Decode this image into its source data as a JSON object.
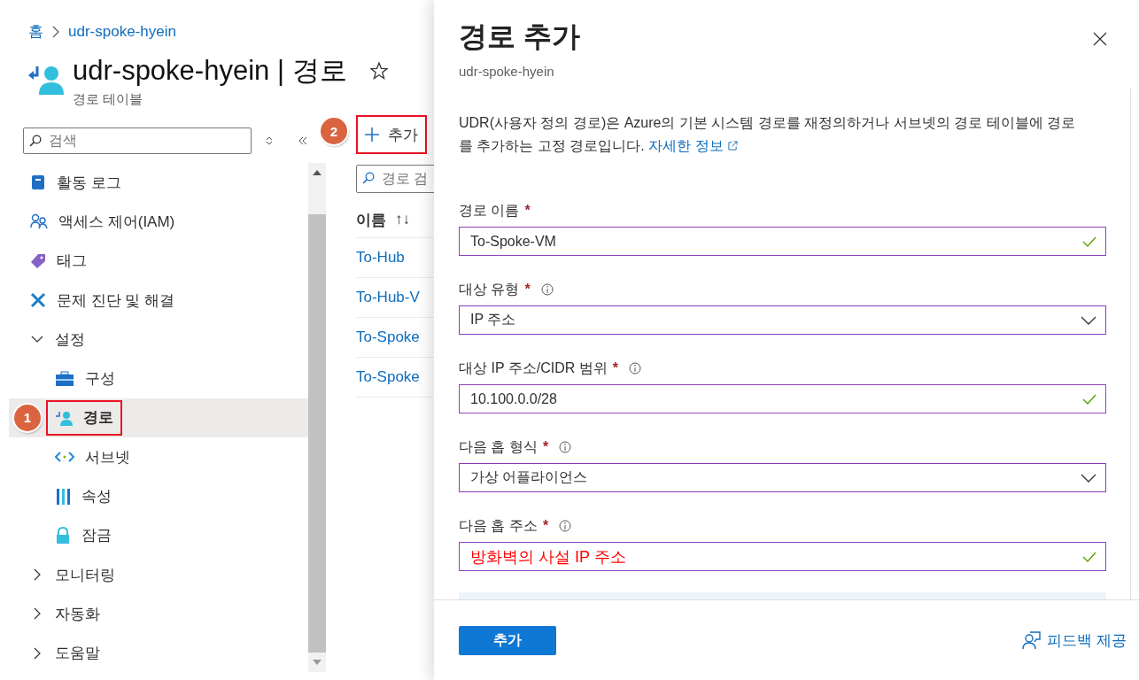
{
  "breadcrumb": [
    {
      "label": "홈"
    },
    {
      "label": "udr-spoke-hyein"
    }
  ],
  "resource": {
    "title": "udr-spoke-hyein | 경로",
    "subtitle": "경로 테이블",
    "favorite": false
  },
  "sidebar": {
    "search": {
      "placeholder": "검색"
    },
    "items": [
      {
        "label": "활동 로그",
        "selected": false
      },
      {
        "label": "액세스 제어(IAM)",
        "selected": false
      },
      {
        "label": "태그",
        "selected": false
      },
      {
        "label": "문제 진단 및 해결",
        "selected": false
      },
      {
        "label": "설정",
        "selected": false,
        "expanded": true,
        "children": [
          {
            "label": "구성",
            "selected": false
          },
          {
            "label": "경로",
            "selected": true,
            "highlighted": true,
            "callout": "1"
          },
          {
            "label": "서브넷",
            "selected": false
          },
          {
            "label": "속성",
            "selected": false
          },
          {
            "label": "잠금",
            "selected": false
          }
        ]
      },
      {
        "label": "모니터링",
        "selected": false,
        "expanded": false
      },
      {
        "label": "자동화",
        "selected": false,
        "expanded": false
      },
      {
        "label": "도움말",
        "selected": false,
        "expanded": false
      }
    ]
  },
  "toolbar": {
    "add_button": {
      "label": "추가",
      "highlighted": true,
      "callout": "2"
    }
  },
  "routes": {
    "filter": {
      "placeholder": "경로 검"
    },
    "columns": [
      {
        "label": "이름",
        "sort": "↑↓"
      }
    ],
    "rows": [
      {
        "name": "To-Hub"
      },
      {
        "name": "To-Hub-V"
      },
      {
        "name": "To-Spoke"
      },
      {
        "name": "To-Spoke"
      }
    ]
  },
  "panel": {
    "title": "경로 추가",
    "subtitle": "udr-spoke-hyein",
    "description": "UDR(사용자 정의 경로)은 Azure의 기본 시스템 경로를 재정의하거나 서브넷의 경로 테이블에 경로를 추가하는 고정 경로입니다.",
    "link": "자세한 정보",
    "fields": [
      {
        "label": "경로 이름",
        "required_mark": "*",
        "info": false,
        "kind": "text",
        "value": "To-Spoke-VM",
        "valid": true,
        "emphasized": false
      },
      {
        "label": "대상 유형",
        "required_mark": "*",
        "info": true,
        "kind": "select",
        "value": "IP 주소",
        "emphasized": false
      },
      {
        "label": "대상 IP 주소/CIDR 범위",
        "required_mark": "*",
        "info": true,
        "kind": "text",
        "value": "10.100.0.0/28",
        "valid": true,
        "emphasized": false
      },
      {
        "label": "다음 홉 형식",
        "required_mark": "*",
        "info": true,
        "kind": "select",
        "value": "가상 어플라이언스",
        "emphasized": false
      },
      {
        "label": "다음 홉 주소",
        "required_mark": "*",
        "info": true,
        "kind": "text",
        "value": "방화벽의 사설 IP 주소",
        "valid": true,
        "emphasized": true
      }
    ],
    "submit": "추가",
    "feedback": "피드백 제공"
  }
}
